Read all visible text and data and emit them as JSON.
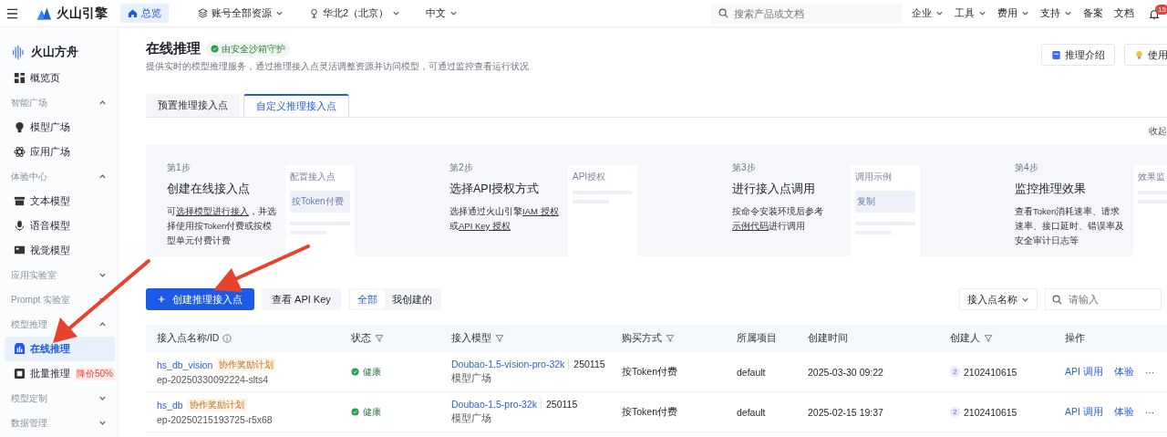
{
  "topbar": {
    "brand": "火山引擎",
    "home_tab": "总览",
    "selectors": [
      "账号全部资源",
      "华北2（北京）",
      "中文"
    ],
    "search": {
      "placeholder": "搜索产品或文档"
    },
    "menus": [
      {
        "label": "企业",
        "dropdown": true
      },
      {
        "label": "工具",
        "dropdown": true
      },
      {
        "label": "费用",
        "dropdown": true
      },
      {
        "label": "支持",
        "dropdown": true
      },
      {
        "label": "备案",
        "dropdown": false
      },
      {
        "label": "文档",
        "dropdown": false
      }
    ],
    "notifications": "15"
  },
  "sidebar": {
    "product": "火山方舟",
    "items": [
      {
        "kind": "item",
        "label": "概览页",
        "selected": false
      },
      {
        "kind": "group",
        "label": "智能广场",
        "expanded": true,
        "children": [
          {
            "label": "模型广场",
            "selected": false
          },
          {
            "label": "应用广场",
            "selected": false
          }
        ]
      },
      {
        "kind": "group",
        "label": "体验中心",
        "expanded": true,
        "children": [
          {
            "label": "文本模型",
            "selected": false
          },
          {
            "label": "语音模型",
            "selected": false
          },
          {
            "label": "视觉模型",
            "selected": false
          }
        ]
      },
      {
        "kind": "group",
        "label": "应用实验室",
        "expanded": false
      },
      {
        "kind": "group",
        "label": "Prompt 实验室",
        "expanded": false
      },
      {
        "kind": "group",
        "label": "模型推理",
        "expanded": true,
        "children": [
          {
            "label": "在线推理",
            "selected": true
          },
          {
            "label": "批量推理",
            "selected": false,
            "badge": "降价50%"
          }
        ]
      },
      {
        "kind": "group",
        "label": "模型定制",
        "expanded": false
      },
      {
        "kind": "group",
        "label": "数据管理",
        "expanded": false
      }
    ]
  },
  "page": {
    "title": "在线推理",
    "badge": "由安全沙箱守护",
    "subtitle": "提供实时的模型推理服务，通过推理接入点灵活调整资源并访问模型，可通过监控查看运行状况",
    "buttons": [
      "推理介绍",
      "使用"
    ]
  },
  "tabs": [
    {
      "label": "预置推理接入点",
      "selected": false
    },
    {
      "label": "自定义推理接入点",
      "selected": true
    }
  ],
  "collapse_link": "收起",
  "steps": [
    {
      "step": "第1步",
      "title": "创建在线接入点",
      "description": [
        {
          "text": "可"
        },
        {
          "text": "选择模型进行接入",
          "link": true
        },
        {
          "text": "，并选择使用按Token付费或按模型单元付费计费"
        }
      ],
      "preview": {
        "title": "配置接入点",
        "label": "按Token付费"
      }
    },
    {
      "step": "第2步",
      "title": "选择API授权方式",
      "description": [
        {
          "text": "选择通过火山引擎"
        },
        {
          "text": "IAM 授权",
          "link": true
        },
        {
          "text": "或"
        },
        {
          "text": "API Key 授权",
          "link": true
        }
      ],
      "preview": {
        "title": "API授权"
      }
    },
    {
      "step": "第3步",
      "title": "进行接入点调用",
      "description": [
        {
          "text": "按命令安装环境后参考"
        },
        {
          "text": "示例代码",
          "link": true
        },
        {
          "text": "进行调用"
        }
      ],
      "preview": {
        "title": "调用示例",
        "label": "复制"
      }
    },
    {
      "step": "第4步",
      "title": "监控推理效果",
      "description": [
        {
          "text": "查看Token消耗速率、请求速率、接口延时、错误率及安全审计日志等"
        }
      ],
      "preview": {
        "title": "效果监"
      }
    }
  ],
  "toolbar": {
    "create_button": "创建推理接入点",
    "apikey_button": "查看 API Key",
    "filter": [
      {
        "label": "全部",
        "selected": true
      },
      {
        "label": "我创建的",
        "selected": false
      }
    ],
    "search_field": "接入点名称",
    "search": {
      "placeholder": "请输入"
    }
  },
  "table": {
    "columns": [
      "接入点名称/ID",
      "状态",
      "接入模型",
      "购买方式",
      "所属项目",
      "创建时间",
      "创建人",
      "操作"
    ],
    "rows": [
      {
        "name": "hs_db_vision",
        "tag": "协作奖励计划",
        "id": "ep-20250330092224-slts4",
        "status": "健康",
        "model": "Doubao-1.5-vision-pro-32k",
        "version": "250115",
        "source": "模型广场",
        "billing": "按Token付费",
        "project": "default",
        "created": "2025-03-30 09:22",
        "creator_avatar": "2",
        "creator": "2102410615",
        "actions": [
          "API 调用",
          "体验"
        ],
        "more": "···"
      },
      {
        "name": "hs_db",
        "tag": "协作奖励计划",
        "id": "ep-20250215193725-r5x68",
        "status": "健康",
        "model": "Doubao-1.5-pro-32k",
        "version": "250115",
        "source": "模型广场",
        "billing": "按Token付费",
        "project": "default",
        "created": "2025-02-15 19:37",
        "creator_avatar": "2",
        "creator": "2102410615",
        "actions": [
          "API 调用",
          "体验"
        ],
        "more": "···"
      }
    ]
  },
  "annotations": [
    {
      "kind": "arrow"
    },
    {
      "kind": "arrow"
    }
  ]
}
